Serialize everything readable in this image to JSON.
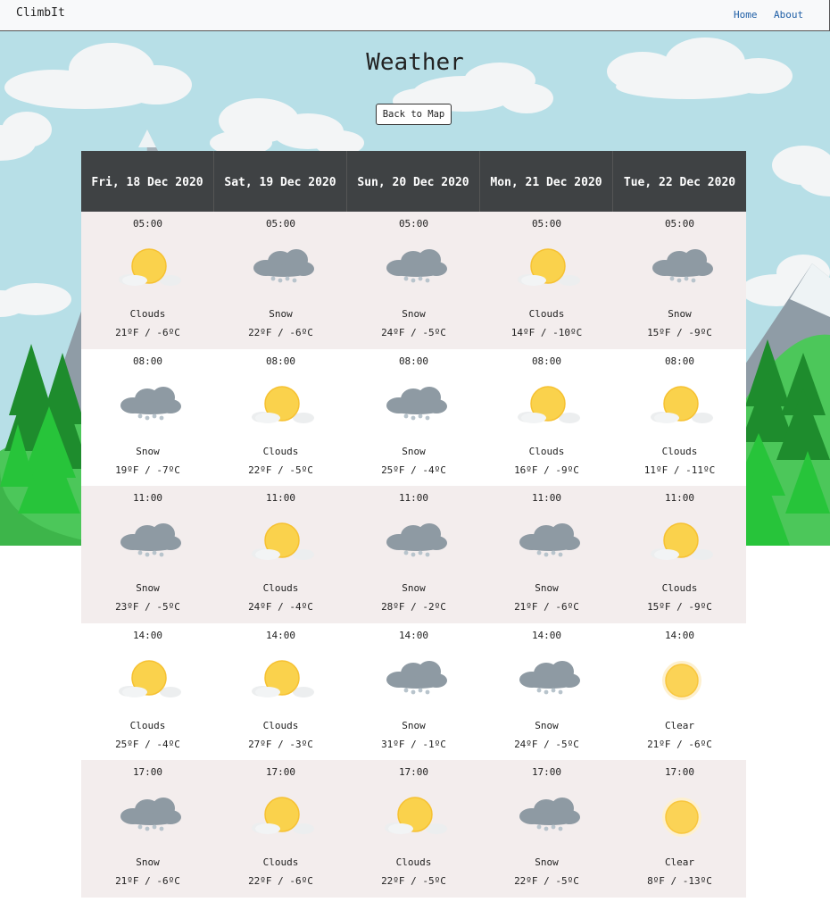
{
  "nav": {
    "brand": "ClimbIt",
    "home": "Home",
    "about": "About"
  },
  "page": {
    "title": "Weather",
    "back_button": "Back to Map"
  },
  "days": [
    "Fri, 18 Dec 2020",
    "Sat, 19 Dec 2020",
    "Sun, 20 Dec 2020",
    "Mon, 21 Dec 2020",
    "Tue, 22 Dec 2020"
  ],
  "rows": [
    {
      "time": "05:00",
      "cells": [
        {
          "cond": "Clouds",
          "temp": "21ºF / -6ºC",
          "icon": "partly-cloudy-icon"
        },
        {
          "cond": "Snow",
          "temp": "22ºF / -6ºC",
          "icon": "snow-cloud-icon"
        },
        {
          "cond": "Snow",
          "temp": "24ºF / -5ºC",
          "icon": "snow-cloud-icon"
        },
        {
          "cond": "Clouds",
          "temp": "14ºF / -10ºC",
          "icon": "partly-cloudy-icon"
        },
        {
          "cond": "Snow",
          "temp": "15ºF / -9ºC",
          "icon": "snow-cloud-icon"
        }
      ]
    },
    {
      "time": "08:00",
      "cells": [
        {
          "cond": "Snow",
          "temp": "19ºF / -7ºC",
          "icon": "snow-cloud-icon"
        },
        {
          "cond": "Clouds",
          "temp": "22ºF / -5ºC",
          "icon": "partly-cloudy-icon"
        },
        {
          "cond": "Snow",
          "temp": "25ºF / -4ºC",
          "icon": "snow-cloud-icon"
        },
        {
          "cond": "Clouds",
          "temp": "16ºF / -9ºC",
          "icon": "partly-cloudy-icon"
        },
        {
          "cond": "Clouds",
          "temp": "11ºF / -11ºC",
          "icon": "partly-cloudy-icon"
        }
      ]
    },
    {
      "time": "11:00",
      "cells": [
        {
          "cond": "Snow",
          "temp": "23ºF / -5ºC",
          "icon": "snow-cloud-icon"
        },
        {
          "cond": "Clouds",
          "temp": "24ºF / -4ºC",
          "icon": "partly-cloudy-icon"
        },
        {
          "cond": "Snow",
          "temp": "28ºF / -2ºC",
          "icon": "snow-cloud-icon"
        },
        {
          "cond": "Snow",
          "temp": "21ºF / -6ºC",
          "icon": "snow-cloud-icon"
        },
        {
          "cond": "Clouds",
          "temp": "15ºF / -9ºC",
          "icon": "partly-cloudy-icon"
        }
      ]
    },
    {
      "time": "14:00",
      "cells": [
        {
          "cond": "Clouds",
          "temp": "25ºF / -4ºC",
          "icon": "partly-cloudy-icon"
        },
        {
          "cond": "Clouds",
          "temp": "27ºF / -3ºC",
          "icon": "partly-cloudy-icon"
        },
        {
          "cond": "Snow",
          "temp": "31ºF / -1ºC",
          "icon": "snow-cloud-icon"
        },
        {
          "cond": "Snow",
          "temp": "24ºF / -5ºC",
          "icon": "snow-cloud-icon"
        },
        {
          "cond": "Clear",
          "temp": "21ºF / -6ºC",
          "icon": "sun-icon"
        }
      ]
    },
    {
      "time": "17:00",
      "cells": [
        {
          "cond": "Snow",
          "temp": "21ºF / -6ºC",
          "icon": "snow-cloud-icon"
        },
        {
          "cond": "Clouds",
          "temp": "22ºF / -6ºC",
          "icon": "partly-cloudy-icon"
        },
        {
          "cond": "Clouds",
          "temp": "22ºF / -5ºC",
          "icon": "partly-cloudy-icon"
        },
        {
          "cond": "Snow",
          "temp": "22ºF / -5ºC",
          "icon": "snow-cloud-icon"
        },
        {
          "cond": "Clear",
          "temp": "8ºF / -13ºC",
          "icon": "sun-icon"
        }
      ]
    }
  ],
  "colors": {
    "sky": "#b7dfe7",
    "table_header": "#3f4244",
    "row_shade": "#f3eded",
    "sun": "#fbd356",
    "storm_cloud": "#8e9aa3",
    "link": "#1f5fa6"
  }
}
